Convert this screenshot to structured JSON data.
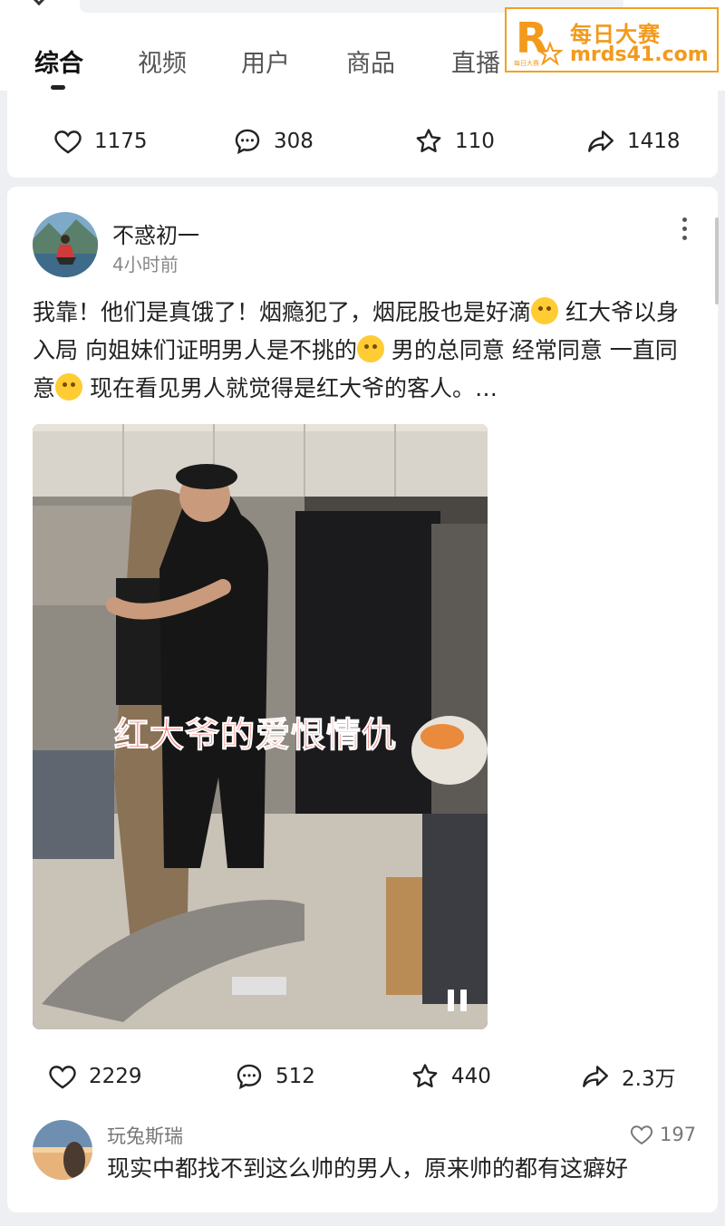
{
  "tabs": [
    "综合",
    "视频",
    "用户",
    "商品",
    "直播"
  ],
  "active_tab_index": 0,
  "watermark": {
    "title": "每日大赛",
    "url": "mrds41.com",
    "logo_letter": "R",
    "logo_subtext": "每日大赛",
    "color": "#f29a1d"
  },
  "prev_post": {
    "likes": "1175",
    "comments": "308",
    "favorites": "110",
    "shares": "1418"
  },
  "post": {
    "author": "不惑初一",
    "time": "4小时前",
    "text_1": "我靠！他们是真饿了！烟瘾犯了，烟屁股也是好滴",
    "text_2": " 红大爷以身入局 向姐妹们证明男人是不挑的",
    "text_3": " 男的总同意 经常同意 一直同意",
    "text_4": " 现在看见男人就觉得是红大爷的客人。…",
    "video_caption": "红大爷的爱恨情仇",
    "likes": "2229",
    "comments": "512",
    "favorites": "440",
    "shares": "2.3万"
  },
  "top_comment": {
    "user": "玩兔斯瑞",
    "likes": "197",
    "text": "现实中都找不到这么帅的男人，原来帅的都有这癖好"
  },
  "icons": [
    "heart-icon",
    "comment-icon",
    "star-icon",
    "share-icon",
    "more-icon",
    "pause-icon"
  ]
}
